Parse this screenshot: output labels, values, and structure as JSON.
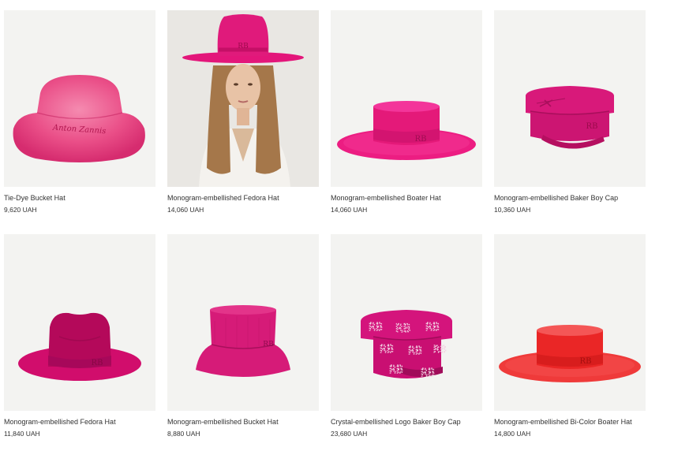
{
  "products": [
    {
      "name": "Tie-Dye Bucket Hat",
      "price": "9,620 UAH",
      "icon": "tie-dye-bucket-hat-image",
      "color": "#e4437f"
    },
    {
      "name": "Monogram-embellished Fedora Hat",
      "price": "14,060 UAH",
      "icon": "model-wearing-fedora-image",
      "color": "#e3167a"
    },
    {
      "name": "Monogram-embellished Boater Hat",
      "price": "14,060 UAH",
      "icon": "boater-hat-image",
      "color": "#ec1d82"
    },
    {
      "name": "Monogram-embellished Baker Boy Cap",
      "price": "10,360 UAH",
      "icon": "baker-boy-cap-image",
      "color": "#d8197a"
    },
    {
      "name": "Monogram-embellished Fedora Hat",
      "price": "11,840 UAH",
      "icon": "fedora-hat-image",
      "color": "#d10d6c"
    },
    {
      "name": "Monogram-embellished Bucket Hat",
      "price": "8,880 UAH",
      "icon": "bucket-hat-image",
      "color": "#d61b78"
    },
    {
      "name": "Crystal-embellished Logo Baker Boy Cap",
      "price": "23,680 UAH",
      "icon": "crystal-baker-boy-cap-image",
      "color": "#d4147c"
    },
    {
      "name": "Monogram-embellished Bi-Color Boater Hat",
      "price": "14,800 UAH",
      "icon": "bi-color-boater-hat-image",
      "color": "#ee2f2f"
    }
  ],
  "logo_text": "RB"
}
